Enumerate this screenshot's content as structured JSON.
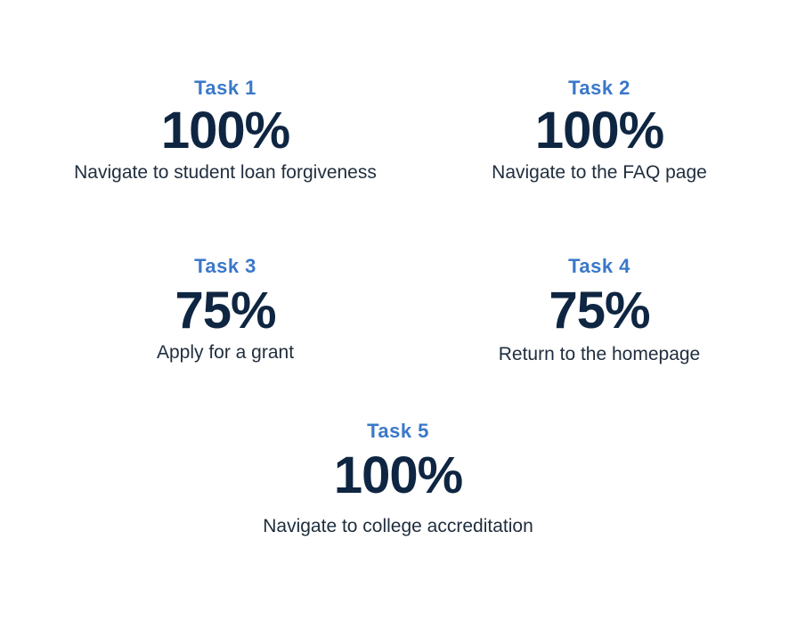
{
  "tasks": [
    {
      "label": "Task 1",
      "value": "100%",
      "description": "Navigate to student loan forgiveness"
    },
    {
      "label": "Task 2",
      "value": "100%",
      "description": "Navigate to the FAQ page"
    },
    {
      "label": "Task 3",
      "value": "75%",
      "description": "Apply for a grant"
    },
    {
      "label": "Task 4",
      "value": "75%",
      "description": "Return to the homepage"
    },
    {
      "label": "Task 5",
      "value": "100%",
      "description": "Navigate to college accreditation"
    }
  ],
  "colors": {
    "label": "#3a78c9",
    "value": "#0f2642",
    "description": "#1f2d3d",
    "background": "#ffffff"
  }
}
